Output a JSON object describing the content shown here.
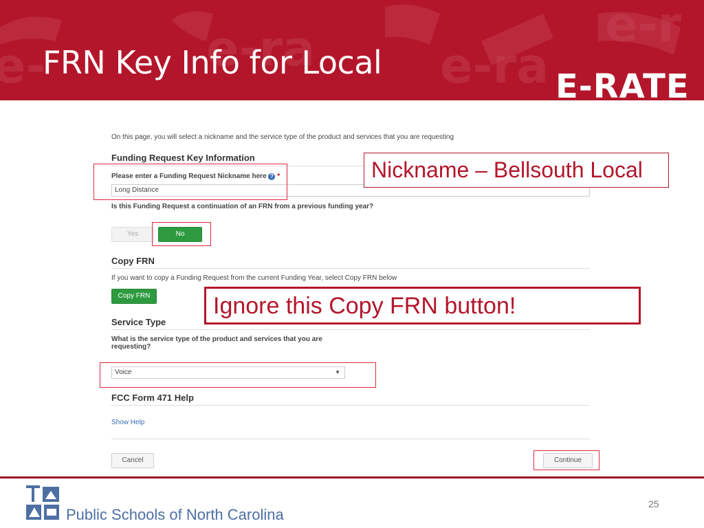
{
  "slide": {
    "title": "FRN Key Info for Local",
    "brand": "E-RATE",
    "page_number": "25",
    "org_name": "Public Schools of North Carolina"
  },
  "form": {
    "intro": "On this page, you will select a nickname and the service type of the product and services that you are requesting",
    "section_key_info": "Funding Request Key Information",
    "nickname_label": "Please enter a Funding Request Nickname here",
    "required_mark": "*",
    "nickname_value": "Long Distance",
    "continuation_question": "Is this Funding Request a continuation of an FRN from a previous funding year?",
    "yes_label": "Yes",
    "no_label": "No",
    "section_copy": "Copy FRN",
    "copy_help": "If you want to copy a Funding Request from the current Funding Year, select Copy FRN below",
    "copy_button": "Copy FRN",
    "section_service": "Service Type",
    "service_question_1": "What is the service type of the product and services that you are",
    "service_question_2": "requesting?",
    "service_value": "Voice",
    "section_help": "FCC Form 471 Help",
    "show_help": "Show Help",
    "cancel": "Cancel",
    "continue": "Continue"
  },
  "callouts": {
    "nickname": "Nickname – Bellsouth Local",
    "ignore": "Ignore this Copy FRN button!"
  },
  "colors": {
    "banner": "#b3162b",
    "highlight": "#e0283c",
    "green_button": "#2e9a3f",
    "org_text": "#4d6fa3"
  },
  "icons": [
    "help-circle-icon",
    "dropdown-caret-icon",
    "org-logo-icon"
  ]
}
